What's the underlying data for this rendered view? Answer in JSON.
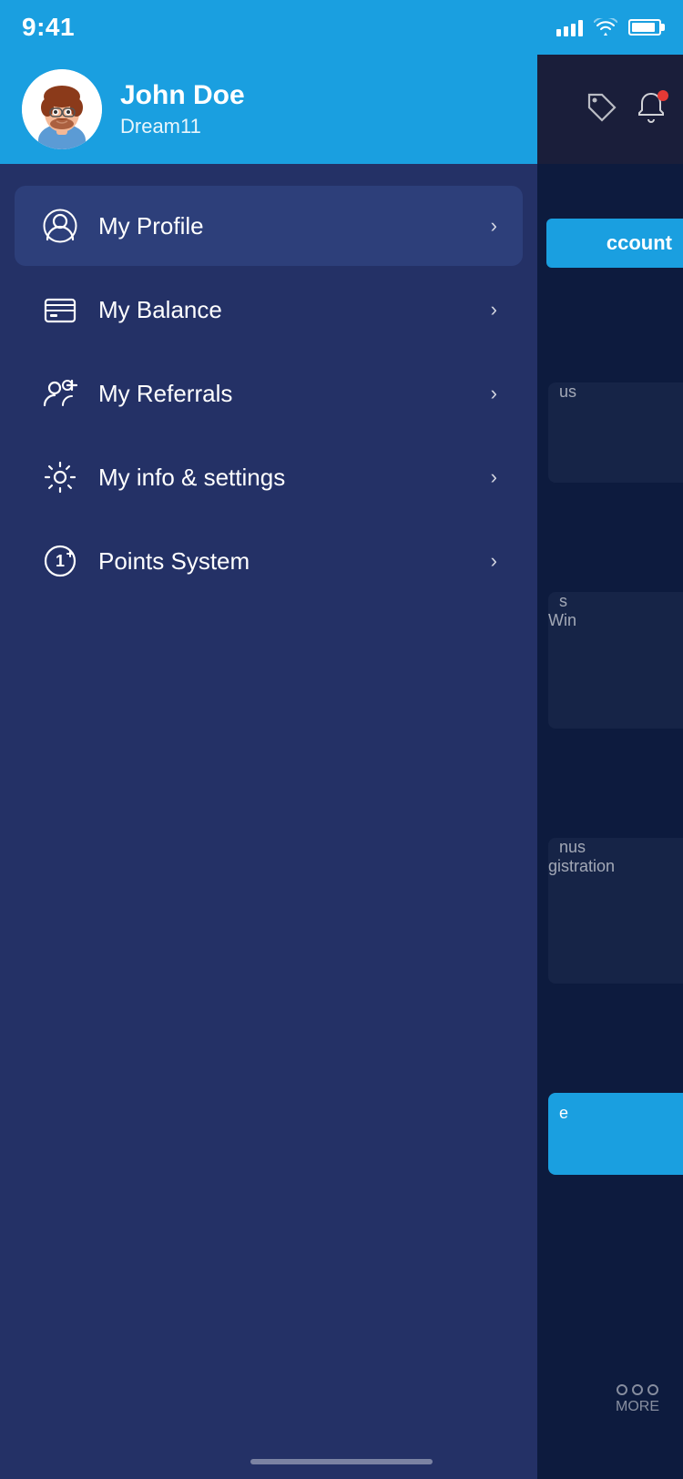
{
  "statusBar": {
    "time": "9:41"
  },
  "header": {
    "userName": "John Doe",
    "userSubtitle": "Dream11"
  },
  "drawer": {
    "userName": "John Doe",
    "userSubtitle": "Dream11",
    "menuItems": [
      {
        "id": "my-profile",
        "label": "My Profile",
        "icon": "profile-icon",
        "active": true
      },
      {
        "id": "my-balance",
        "label": "My Balance",
        "icon": "balance-icon",
        "active": false
      },
      {
        "id": "my-referrals",
        "label": "My Referrals",
        "icon": "referrals-icon",
        "active": false
      },
      {
        "id": "my-info-settings",
        "label": "My info & settings",
        "icon": "settings-icon",
        "active": false
      },
      {
        "id": "points-system",
        "label": "Points System",
        "icon": "points-icon",
        "active": false
      }
    ]
  },
  "rightPanel": {
    "accountBtnText": "ccount",
    "card1Text": "us",
    "card2Text": "s\nWin",
    "card3Text": "nus\nqistration",
    "moreBtnText": "MORE"
  }
}
